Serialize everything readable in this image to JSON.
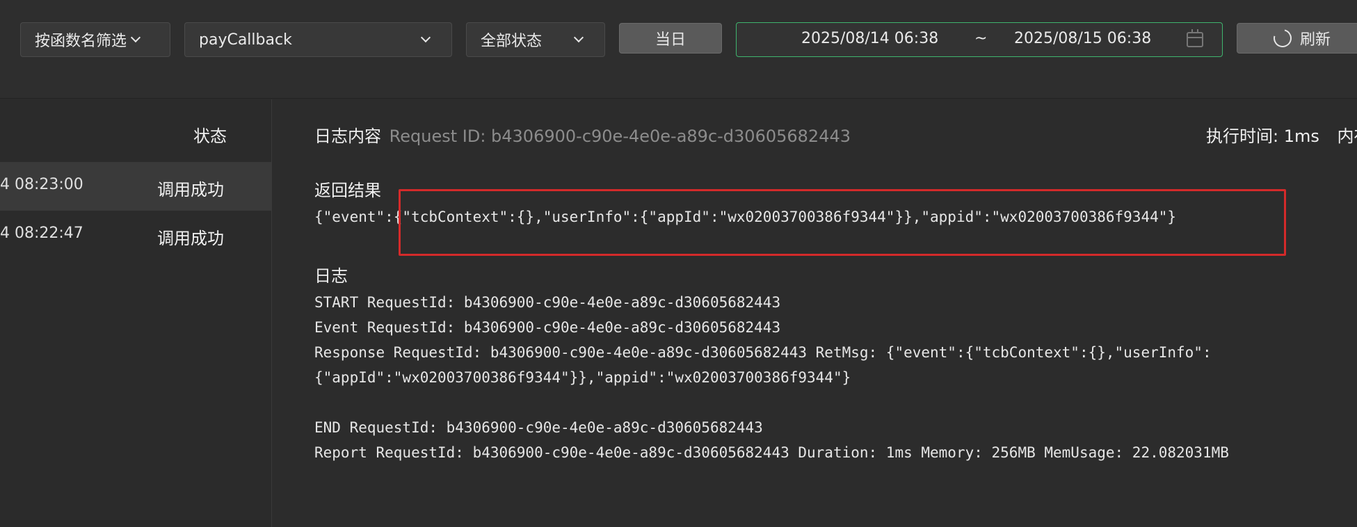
{
  "toolbar": {
    "function_filter_label": "按函数名筛选",
    "function_name": "payCallback",
    "status_filter": "全部状态",
    "today_label": "当日",
    "date_start": "2025/08/14 06:38",
    "date_separator": "~",
    "date_end": "2025/08/15 06:38",
    "refresh_label": "刷新"
  },
  "list": {
    "status_header": "状态",
    "rows": [
      {
        "time": "4 08:23:00",
        "status": "调用成功",
        "selected": true
      },
      {
        "time": "4 08:22:47",
        "status": "调用成功",
        "selected": false
      }
    ]
  },
  "detail": {
    "log_title": "日志内容",
    "request_id_label": "Request ID: b4306900-c90e-4e0e-a89c-d30605682443",
    "exec_time": "执行时间: 1ms",
    "exec_extra": "内存",
    "return_title": "返回结果",
    "return_value": "{\"event\":{\"tcbContext\":{},\"userInfo\":{\"appId\":\"wx02003700386f9344\"}},\"appid\":\"wx02003700386f9344\"}",
    "log_section_title": "日志",
    "log_lines": [
      "START RequestId: b4306900-c90e-4e0e-a89c-d30605682443",
      "Event RequestId: b4306900-c90e-4e0e-a89c-d30605682443",
      "Response RequestId: b4306900-c90e-4e0e-a89c-d30605682443 RetMsg: {\"event\":{\"tcbContext\":{},\"userInfo\":",
      "{\"appId\":\"wx02003700386f9344\"}},\"appid\":\"wx02003700386f9344\"}",
      "",
      "END RequestId: b4306900-c90e-4e0e-a89c-d30605682443",
      "Report RequestId: b4306900-c90e-4e0e-a89c-d30605682443 Duration: 1ms Memory: 256MB MemUsage: 22.082031MB"
    ]
  },
  "colors": {
    "accent_green": "#3fb46e",
    "highlight_red": "#d42a2a"
  }
}
